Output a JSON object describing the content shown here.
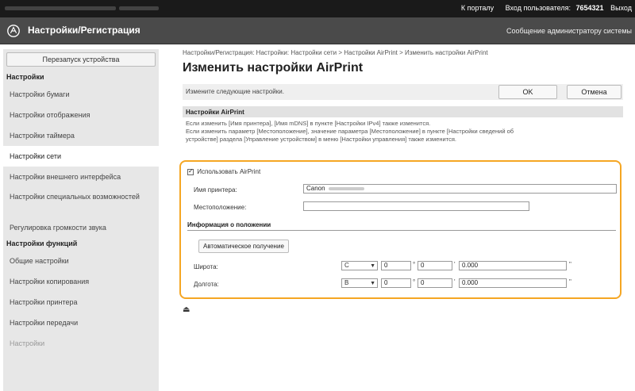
{
  "topbar": {
    "portal": "К порталу",
    "login_label": "Вход пользователя:",
    "user": "7654321",
    "logout": "Выход"
  },
  "app": {
    "title": "Настройки/Регистрация",
    "admin_message": "Сообщение администратору системы"
  },
  "sidebar": {
    "reboot": "Перезапуск устройства",
    "section1": "Настройки",
    "items": [
      "Настройки бумаги",
      "Настройки отображения",
      "Настройки таймера",
      "Настройки сети",
      "Настройки внешнего интерфейса",
      "Настройки специальных возможностей",
      "Регулировка громкости звука"
    ],
    "section2": "Настройки функций",
    "items2": [
      "Общие настройки",
      "Настройки копирования",
      "Настройки принтера",
      "Настройки передачи",
      "Настройки"
    ]
  },
  "main": {
    "breadcrumb": "Настройки/Регистрация: Настройки: Настройки сети > Настройки AirPrint > Изменить настройки AirPrint",
    "title": "Изменить настройки AirPrint",
    "instruction": "Измените следующие настройки.",
    "ok": "OK",
    "cancel": "Отмена",
    "section_title": "Настройки AirPrint",
    "section_text1": "Если изменить [Имя принтера], [Имя mDNS] в пункте [Настройки IPv4] также изменится.",
    "section_text2": "Если изменить параметр [Местоположение], значение параметра [Местоположение] в пункте [Настройки сведений об",
    "section_text3": "устройстве] раздела [Управление устройством] в меню [Настройки управления] также изменится.",
    "use_airprint": "Использовать AirPrint",
    "printer_name_label": "Имя принтера:",
    "printer_name_value": "Canon",
    "location_label": "Местоположение:",
    "location_value": "",
    "position_info": "Информация о положении",
    "auto_get": "Автоматическое получение",
    "latitude_label": "Широта:",
    "latitude": {
      "dir": "С",
      "deg": "0",
      "min": "0",
      "sec": "0.000"
    },
    "longitude_label": "Долгота:",
    "longitude": {
      "dir": "В",
      "deg": "0",
      "min": "0",
      "sec": "0.000"
    },
    "deg_sym": "°",
    "min_sym": "'",
    "sec_sym": "\""
  },
  "colors": {
    "highlight": "#f5a623",
    "topbar": "#1a1a1a",
    "appbar": "#4a4a4a"
  }
}
